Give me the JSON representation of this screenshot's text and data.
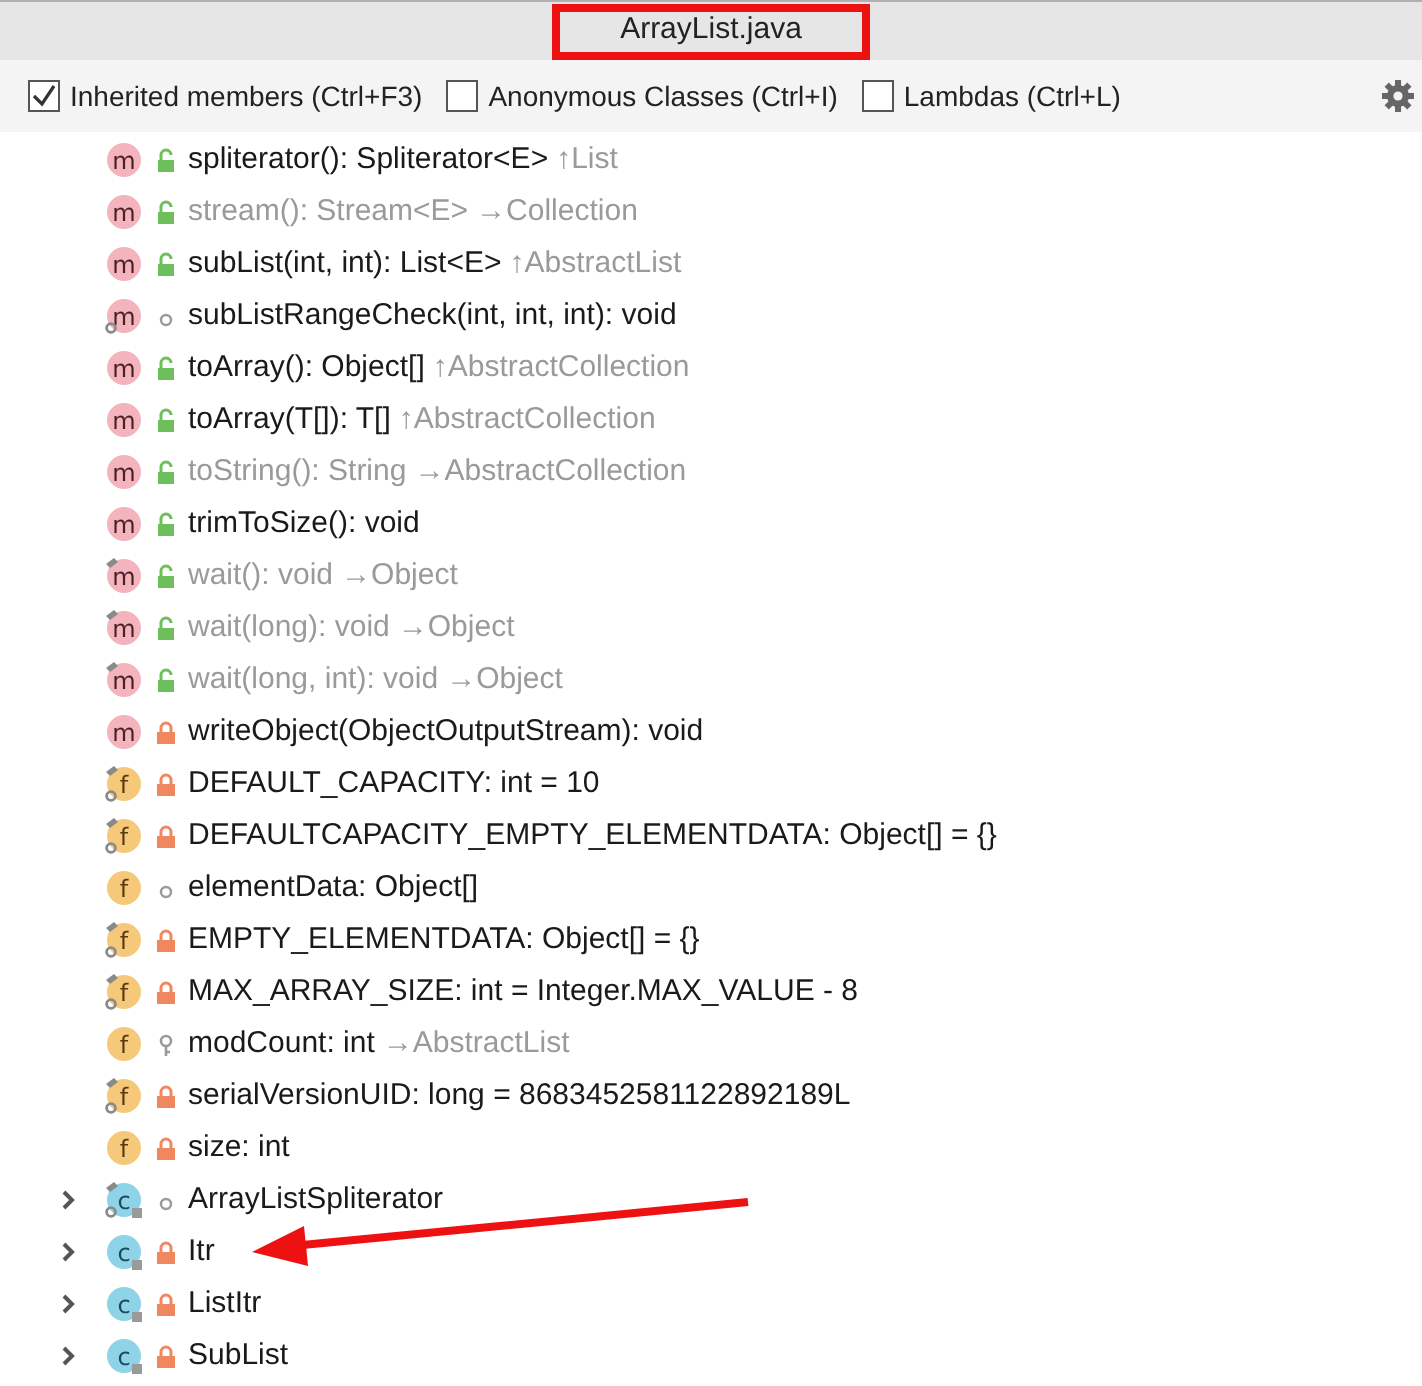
{
  "window": {
    "title": "ArrayList.java"
  },
  "options": [
    {
      "label": "Inherited members (Ctrl+F3)",
      "checked": true
    },
    {
      "label": "Anonymous Classes (Ctrl+I)",
      "checked": false
    },
    {
      "label": "Lambdas (Ctrl+L)",
      "checked": false
    }
  ],
  "members": [
    {
      "kind": "method",
      "icon": "m",
      "access": {
        "kind": "public"
      },
      "static": false,
      "final": false,
      "inherited": false,
      "text": "spliterator(): Spliterator<E>",
      "origin": "↑List"
    },
    {
      "kind": "method",
      "icon": "m",
      "access": {
        "kind": "public"
      },
      "static": false,
      "final": false,
      "inherited": true,
      "text": "stream(): Stream<E>",
      "origin": "→Collection"
    },
    {
      "kind": "method",
      "icon": "m",
      "access": {
        "kind": "public"
      },
      "static": false,
      "final": false,
      "inherited": false,
      "text": "subList(int, int): List<E>",
      "origin": "↑AbstractList"
    },
    {
      "kind": "method",
      "icon": "m",
      "access": {
        "kind": "package"
      },
      "static": true,
      "final": false,
      "inherited": false,
      "text": "subListRangeCheck(int, int, int): void"
    },
    {
      "kind": "method",
      "icon": "m",
      "access": {
        "kind": "public"
      },
      "static": false,
      "final": false,
      "inherited": false,
      "text": "toArray(): Object[]",
      "origin": "↑AbstractCollection"
    },
    {
      "kind": "method",
      "icon": "m",
      "access": {
        "kind": "public"
      },
      "static": false,
      "final": false,
      "inherited": false,
      "text": "toArray(T[]): T[]",
      "origin": "↑AbstractCollection"
    },
    {
      "kind": "method",
      "icon": "m",
      "access": {
        "kind": "public"
      },
      "static": false,
      "final": false,
      "inherited": true,
      "text": "toString(): String",
      "origin": "→AbstractCollection"
    },
    {
      "kind": "method",
      "icon": "m",
      "access": {
        "kind": "public"
      },
      "static": false,
      "final": false,
      "inherited": false,
      "text": "trimToSize(): void"
    },
    {
      "kind": "method",
      "icon": "m",
      "access": {
        "kind": "public"
      },
      "static": false,
      "final": true,
      "inherited": true,
      "text": "wait(): void",
      "origin": "→Object"
    },
    {
      "kind": "method",
      "icon": "m",
      "access": {
        "kind": "public"
      },
      "static": false,
      "final": true,
      "inherited": true,
      "text": "wait(long): void",
      "origin": "→Object"
    },
    {
      "kind": "method",
      "icon": "m",
      "access": {
        "kind": "public"
      },
      "static": false,
      "final": true,
      "inherited": true,
      "text": "wait(long, int): void",
      "origin": "→Object"
    },
    {
      "kind": "method",
      "icon": "m",
      "access": {
        "kind": "private"
      },
      "static": false,
      "final": false,
      "inherited": false,
      "text": "writeObject(ObjectOutputStream): void"
    },
    {
      "kind": "field",
      "icon": "f",
      "access": {
        "kind": "private"
      },
      "static": true,
      "final": true,
      "inherited": false,
      "text": "DEFAULT_CAPACITY: int = 10"
    },
    {
      "kind": "field",
      "icon": "f",
      "access": {
        "kind": "private"
      },
      "static": true,
      "final": true,
      "inherited": false,
      "text": "DEFAULTCAPACITY_EMPTY_ELEMENTDATA: Object[] = {}"
    },
    {
      "kind": "field",
      "icon": "f",
      "access": {
        "kind": "package"
      },
      "static": false,
      "final": false,
      "inherited": false,
      "text": "elementData: Object[]"
    },
    {
      "kind": "field",
      "icon": "f",
      "access": {
        "kind": "private"
      },
      "static": true,
      "final": true,
      "inherited": false,
      "text": "EMPTY_ELEMENTDATA: Object[] = {}"
    },
    {
      "kind": "field",
      "icon": "f",
      "access": {
        "kind": "private"
      },
      "static": true,
      "final": true,
      "inherited": false,
      "text": "MAX_ARRAY_SIZE: int = Integer.MAX_VALUE - 8"
    },
    {
      "kind": "field",
      "icon": "f",
      "access": {
        "kind": "protected"
      },
      "static": false,
      "final": false,
      "inherited": false,
      "text": "modCount: int",
      "origin": "→AbstractList"
    },
    {
      "kind": "field",
      "icon": "f",
      "access": {
        "kind": "private"
      },
      "static": true,
      "final": true,
      "inherited": false,
      "text": "serialVersionUID: long = 8683452581122892189L"
    },
    {
      "kind": "field",
      "icon": "f",
      "access": {
        "kind": "private"
      },
      "static": false,
      "final": false,
      "inherited": false,
      "text": "size: int"
    },
    {
      "kind": "class",
      "icon": "c",
      "access": {
        "kind": "package"
      },
      "static": true,
      "final": true,
      "inherited": false,
      "expanded": false,
      "text": "ArrayListSpliterator"
    },
    {
      "kind": "class",
      "icon": "c",
      "access": {
        "kind": "private"
      },
      "static": false,
      "final": false,
      "inherited": false,
      "expanded": false,
      "text": "Itr"
    },
    {
      "kind": "class",
      "icon": "c",
      "access": {
        "kind": "private"
      },
      "static": false,
      "final": false,
      "inherited": false,
      "expanded": false,
      "text": "ListItr"
    },
    {
      "kind": "class",
      "icon": "c",
      "access": {
        "kind": "private"
      },
      "static": false,
      "final": false,
      "inherited": false,
      "expanded": false,
      "text": "SubList"
    }
  ]
}
